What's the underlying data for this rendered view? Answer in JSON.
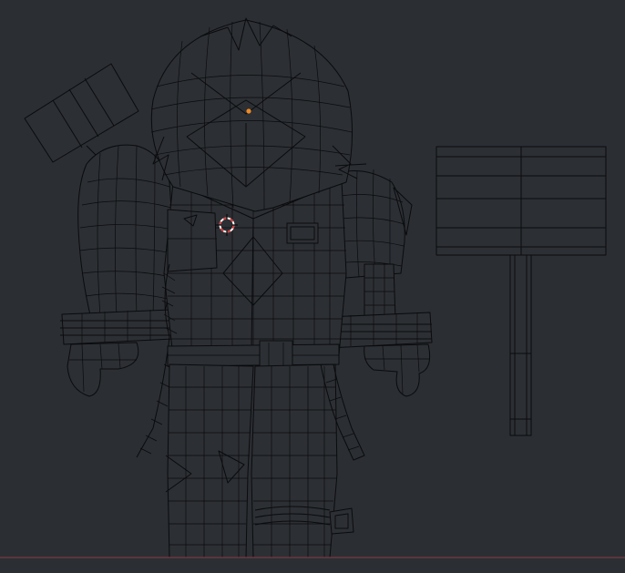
{
  "viewport": {
    "mode": "wireframe",
    "background_color": "#2b2e33",
    "wire_color": "#0a0b0d",
    "ground_axis_color": "#7a3a44",
    "cursor": "3d-cursor-icon",
    "origin_color": "#f08a24"
  }
}
